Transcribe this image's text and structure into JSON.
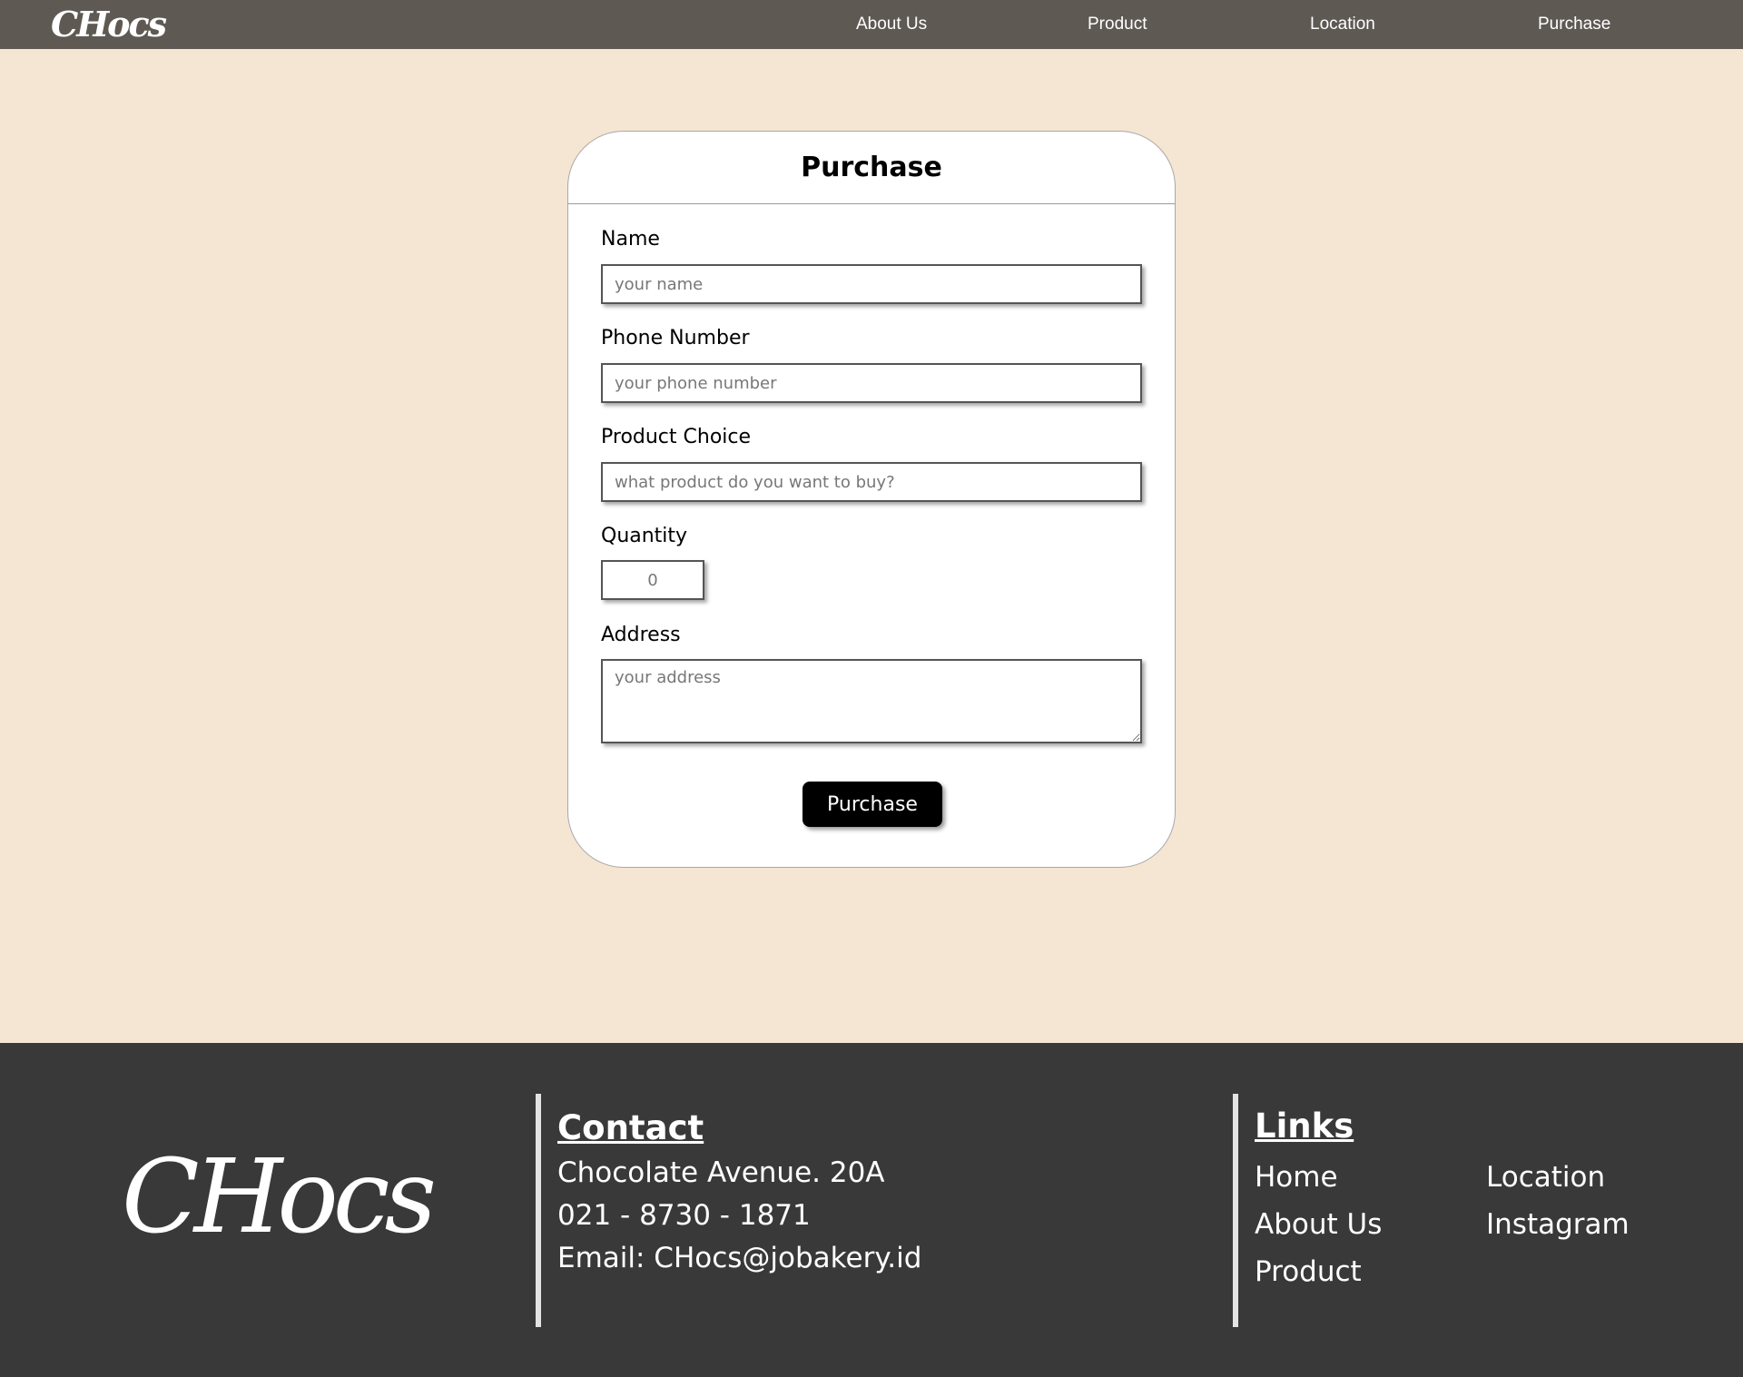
{
  "nav": {
    "logo": "CHocs",
    "links": [
      "About Us",
      "Product",
      "Location",
      "Purchase"
    ]
  },
  "form": {
    "title": "Purchase",
    "name_label": "Name",
    "name_placeholder": "your name",
    "phone_label": "Phone Number",
    "phone_placeholder": "your phone number",
    "product_label": "Product Choice",
    "product_placeholder": "what product do you want to buy?",
    "quantity_label": "Quantity",
    "quantity_placeholder": "0",
    "address_label": "Address",
    "address_placeholder": "your address",
    "submit_label": "Purchase"
  },
  "footer": {
    "logo": "CHocs",
    "contact": {
      "heading": "Contact",
      "address": "Chocolate Avenue. 20A",
      "phone": "021 - 8730 - 1871",
      "email": "Email: CHocs@jobakery.id"
    },
    "links": {
      "heading": "Links",
      "items": [
        "Home",
        "About Us",
        "Product",
        "Location",
        "Instagram"
      ]
    }
  },
  "colors": {
    "nav_bg": "#5f5954",
    "page_bg": "#f5e5d3",
    "footer_bg": "#393939",
    "button_bg": "#000000"
  }
}
